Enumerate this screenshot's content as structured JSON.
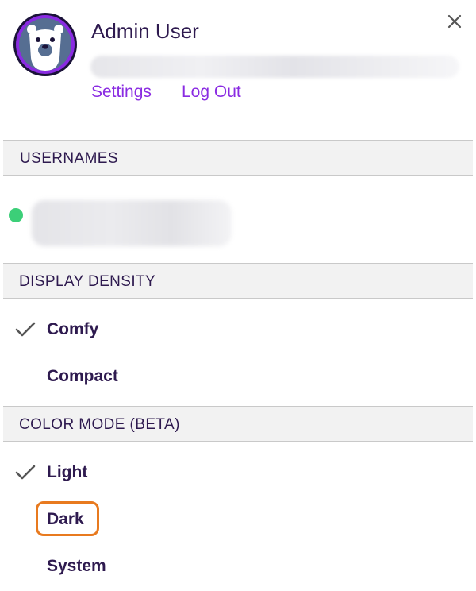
{
  "profile": {
    "name": "Admin User",
    "links": {
      "settings": "Settings",
      "logout": "Log Out"
    }
  },
  "sections": {
    "usernames": {
      "title": "USERNAMES",
      "status": "online"
    },
    "density": {
      "title": "DISPLAY DENSITY",
      "options": [
        {
          "label": "Comfy",
          "selected": true
        },
        {
          "label": "Compact",
          "selected": false
        }
      ]
    },
    "color_mode": {
      "title": "COLOR MODE (BETA)",
      "options": [
        {
          "label": "Light",
          "selected": true
        },
        {
          "label": "Dark",
          "selected": false,
          "highlighted": true
        },
        {
          "label": "System",
          "selected": false
        }
      ]
    }
  },
  "icons": {
    "close": "close-icon",
    "check": "check-icon",
    "avatar": "bear-avatar"
  },
  "colors": {
    "text": "#2e1a4f",
    "link": "#8a2be2",
    "online": "#3ccf78",
    "highlight": "#e87a1f",
    "section_bg": "#f2f2f2"
  }
}
